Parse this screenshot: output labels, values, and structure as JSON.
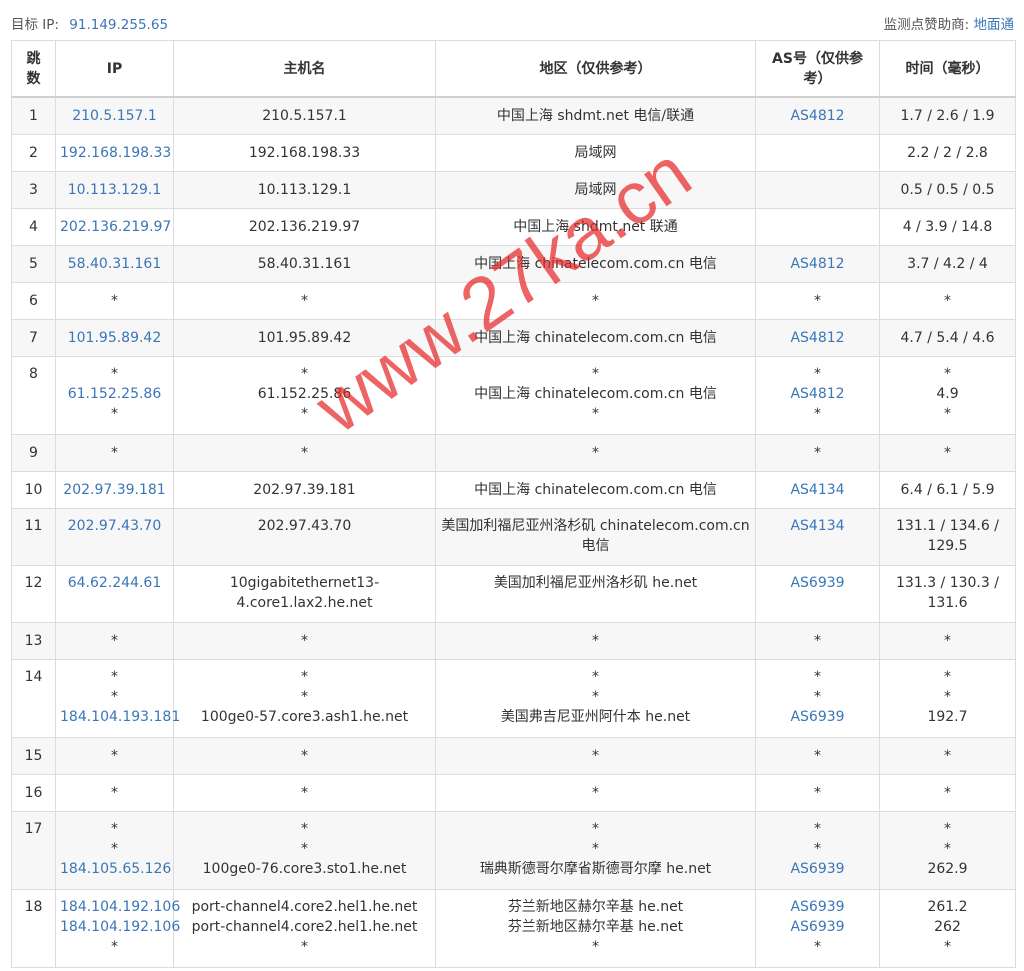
{
  "header": {
    "target_label": "目标 IP:",
    "target_ip": "91.149.255.65",
    "sponsor_label": "监测点赞助商:",
    "sponsor_name": "地面通"
  },
  "columns": [
    "跳数",
    "IP",
    "主机名",
    "地区（仅供参考）",
    "AS号（仅供参考）",
    "时间（毫秒）"
  ],
  "rows": [
    {
      "hop": "1",
      "ip": [
        "210.5.157.1"
      ],
      "host": [
        "210.5.157.1"
      ],
      "region": [
        "中国上海 shdmt.net 电信/联通"
      ],
      "as": [
        "AS4812"
      ],
      "time": [
        "1.7 / 2.6 / 1.9"
      ]
    },
    {
      "hop": "2",
      "ip": [
        "192.168.198.33"
      ],
      "host": [
        "192.168.198.33"
      ],
      "region": [
        "局域网"
      ],
      "as": [
        ""
      ],
      "time": [
        "2.2 / 2 / 2.8"
      ]
    },
    {
      "hop": "3",
      "ip": [
        "10.113.129.1"
      ],
      "host": [
        "10.113.129.1"
      ],
      "region": [
        "局域网"
      ],
      "as": [
        ""
      ],
      "time": [
        "0.5 / 0.5 / 0.5"
      ]
    },
    {
      "hop": "4",
      "ip": [
        "202.136.219.97"
      ],
      "host": [
        "202.136.219.97"
      ],
      "region": [
        "中国上海 shdmt.net 联通"
      ],
      "as": [
        ""
      ],
      "time": [
        "4 / 3.9 / 14.8"
      ]
    },
    {
      "hop": "5",
      "ip": [
        "58.40.31.161"
      ],
      "host": [
        "58.40.31.161"
      ],
      "region": [
        "中国上海 chinatelecom.com.cn 电信"
      ],
      "as": [
        "AS4812"
      ],
      "time": [
        "3.7 / 4.2 / 4"
      ]
    },
    {
      "hop": "6",
      "ip": [
        "*"
      ],
      "host": [
        "*"
      ],
      "region": [
        "*"
      ],
      "as": [
        "*"
      ],
      "time": [
        "*"
      ]
    },
    {
      "hop": "7",
      "ip": [
        "101.95.89.42"
      ],
      "host": [
        "101.95.89.42"
      ],
      "region": [
        "中国上海 chinatelecom.com.cn 电信"
      ],
      "as": [
        "AS4812"
      ],
      "time": [
        "4.7 / 5.4 / 4.6"
      ]
    },
    {
      "hop": "8",
      "ip": [
        "*",
        "61.152.25.86",
        "*"
      ],
      "host": [
        "*",
        "61.152.25.86",
        "*"
      ],
      "region": [
        "*",
        "中国上海 chinatelecom.com.cn 电信",
        "*"
      ],
      "as": [
        "*",
        "AS4812",
        "*"
      ],
      "time": [
        "*",
        "4.9",
        "*"
      ]
    },
    {
      "hop": "9",
      "ip": [
        "*"
      ],
      "host": [
        "*"
      ],
      "region": [
        "*"
      ],
      "as": [
        "*"
      ],
      "time": [
        "*"
      ]
    },
    {
      "hop": "10",
      "ip": [
        "202.97.39.181"
      ],
      "host": [
        "202.97.39.181"
      ],
      "region": [
        "中国上海 chinatelecom.com.cn 电信"
      ],
      "as": [
        "AS4134"
      ],
      "time": [
        "6.4 / 6.1 / 5.9"
      ]
    },
    {
      "hop": "11",
      "ip": [
        "202.97.43.70"
      ],
      "host": [
        "202.97.43.70"
      ],
      "region": [
        "美国加利福尼亚州洛杉矶 chinatelecom.com.cn 电信"
      ],
      "as": [
        "AS4134"
      ],
      "time": [
        "131.1 / 134.6 / 129.5"
      ]
    },
    {
      "hop": "12",
      "ip": [
        "64.62.244.61"
      ],
      "host": [
        "10gigabitethernet13-4.core1.lax2.he.net"
      ],
      "region": [
        "美国加利福尼亚州洛杉矶 he.net"
      ],
      "as": [
        "AS6939"
      ],
      "time": [
        "131.3 / 130.3 / 131.6"
      ]
    },
    {
      "hop": "13",
      "ip": [
        "*"
      ],
      "host": [
        "*"
      ],
      "region": [
        "*"
      ],
      "as": [
        "*"
      ],
      "time": [
        "*"
      ]
    },
    {
      "hop": "14",
      "ip": [
        "*",
        "*",
        "184.104.193.181"
      ],
      "host": [
        "*",
        "*",
        "100ge0-57.core3.ash1.he.net"
      ],
      "region": [
        "*",
        "*",
        "美国弗吉尼亚州阿什本 he.net"
      ],
      "as": [
        "*",
        "*",
        "AS6939"
      ],
      "time": [
        "*",
        "*",
        "192.7"
      ]
    },
    {
      "hop": "15",
      "ip": [
        "*"
      ],
      "host": [
        "*"
      ],
      "region": [
        "*"
      ],
      "as": [
        "*"
      ],
      "time": [
        "*"
      ]
    },
    {
      "hop": "16",
      "ip": [
        "*"
      ],
      "host": [
        "*"
      ],
      "region": [
        "*"
      ],
      "as": [
        "*"
      ],
      "time": [
        "*"
      ]
    },
    {
      "hop": "17",
      "ip": [
        "*",
        "*",
        "184.105.65.126"
      ],
      "host": [
        "*",
        "*",
        "100ge0-76.core3.sto1.he.net"
      ],
      "region": [
        "*",
        "*",
        "瑞典斯德哥尔摩省斯德哥尔摩 he.net"
      ],
      "as": [
        "*",
        "*",
        "AS6939"
      ],
      "time": [
        "*",
        "*",
        "262.9"
      ]
    },
    {
      "hop": "18",
      "ip": [
        "184.104.192.106",
        "184.104.192.106",
        "*"
      ],
      "host": [
        "port-channel4.core2.hel1.he.net",
        "port-channel4.core2.hel1.he.net",
        "*"
      ],
      "region": [
        "芬兰新地区赫尔辛基 he.net",
        "芬兰新地区赫尔辛基 he.net",
        "*"
      ],
      "as": [
        "AS6939",
        "AS6939",
        "*"
      ],
      "time": [
        "261.2",
        "262",
        "*"
      ]
    }
  ],
  "watermark": "www.27ka.cn"
}
